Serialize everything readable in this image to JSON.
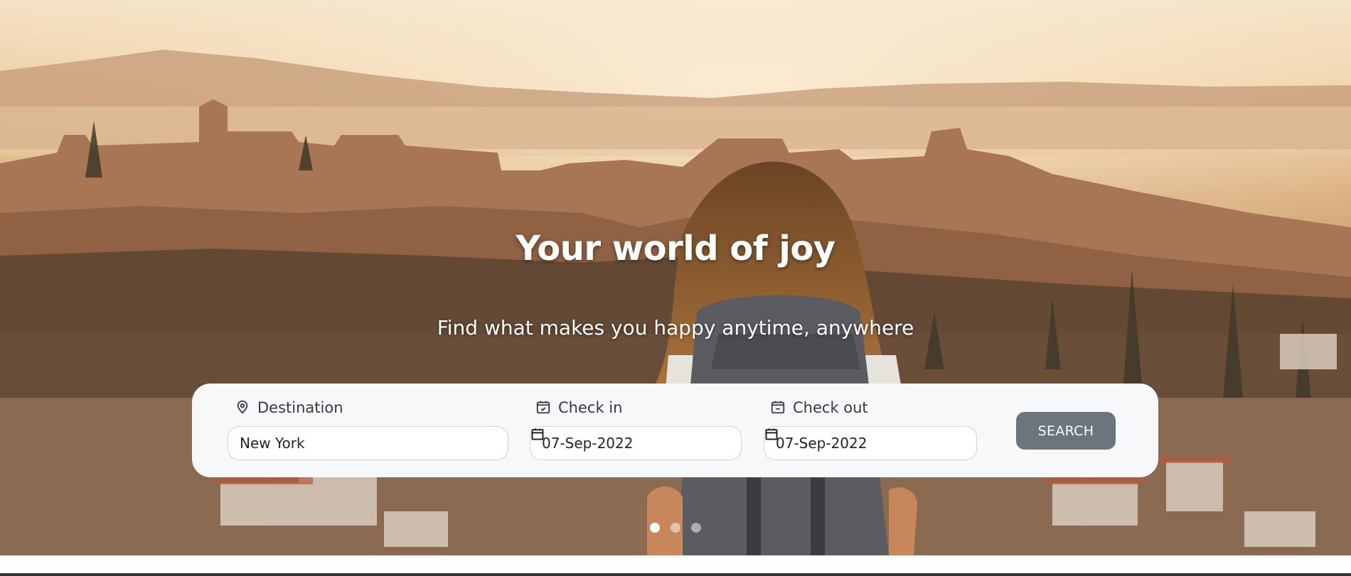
{
  "hero": {
    "title": "Your world of joy",
    "subtitle": "Find what makes you happy anytime, anywhere"
  },
  "search": {
    "destination": {
      "label": "Destination",
      "icon": "map-pin-icon",
      "value": "New York"
    },
    "check_in": {
      "label": "Check in",
      "icon": "calendar-check-icon",
      "value": "07-Sep-2022"
    },
    "check_out": {
      "label": "Check out",
      "icon": "calendar-minus-icon",
      "value": "07-Sep-2022"
    },
    "button_label": "SEARCH"
  },
  "carousel": {
    "slide_count": 3,
    "active_index": 0
  },
  "colors": {
    "button": "#6c757d",
    "card": "#f7f8fa",
    "text": "#343a40"
  }
}
